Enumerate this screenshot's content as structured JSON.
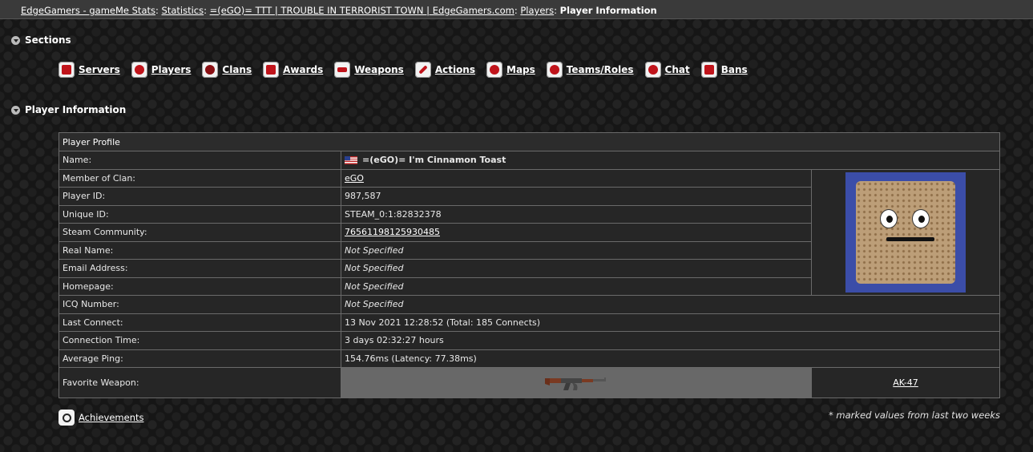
{
  "breadcrumb": {
    "site": "EdgeGamers - gameMe Stats",
    "statistics": "Statistics",
    "server": "=(eGO)= TTT | TROUBLE IN TERRORIST TOWN | EdgeGamers.com",
    "players": "Players",
    "current": "Player Information"
  },
  "sections": {
    "title": "Sections",
    "items": [
      {
        "label": "Servers",
        "icon": "server-icon"
      },
      {
        "label": "Players",
        "icon": "player-icon"
      },
      {
        "label": "Clans",
        "icon": "clan-icon"
      },
      {
        "label": "Awards",
        "icon": "trophy-icon"
      },
      {
        "label": "Weapons",
        "icon": "gun-icon"
      },
      {
        "label": "Actions",
        "icon": "wrench-icon"
      },
      {
        "label": "Maps",
        "icon": "crosshair-icon"
      },
      {
        "label": "Teams/Roles",
        "icon": "swap-icon"
      },
      {
        "label": "Chat",
        "icon": "chat-icon"
      },
      {
        "label": "Bans",
        "icon": "ban-icon"
      }
    ]
  },
  "player_info": {
    "title": "Player Information",
    "profile_header": "Player Profile",
    "rows": {
      "name": {
        "label": "Name:",
        "value": "=(eGO)= I'm Cinnamon Toast",
        "flag": "us-flag-icon"
      },
      "clan": {
        "label": "Member of Clan:",
        "value": "eGO"
      },
      "player_id": {
        "label": "Player ID:",
        "value": "987,587"
      },
      "unique_id": {
        "label": "Unique ID:",
        "value": "STEAM_0:1:82832378"
      },
      "steam": {
        "label": "Steam Community:",
        "value": "76561198125930485"
      },
      "real_name": {
        "label": "Real Name:",
        "value": "Not Specified"
      },
      "email": {
        "label": "Email Address:",
        "value": "Not Specified"
      },
      "homepage": {
        "label": "Homepage:",
        "value": "Not Specified"
      },
      "icq": {
        "label": "ICQ Number:",
        "value": "Not Specified"
      },
      "last_connect": {
        "label": "Last Connect:",
        "value": "13 Nov 2021 12:28:52 (Total: 185 Connects)"
      },
      "connection_time": {
        "label": "Connection Time:",
        "value": "3 days 02:32:27 hours"
      },
      "avg_ping": {
        "label": "Average Ping:",
        "value": "154.76ms (Latency: 77.38ms)"
      },
      "fav_weapon": {
        "label": "Favorite Weapon:",
        "value": "AK-47",
        "icon": "ak47-icon"
      }
    },
    "avatar": "cinnamon-toast-avatar"
  },
  "footer": {
    "achievements": "Achievements",
    "note": "* marked values from last two weeks"
  },
  "colors": {
    "background": "#161616",
    "topbar": "#3a3a3a",
    "nav_icon_accent": "#c0141b",
    "weapon_cell": "#686868"
  }
}
